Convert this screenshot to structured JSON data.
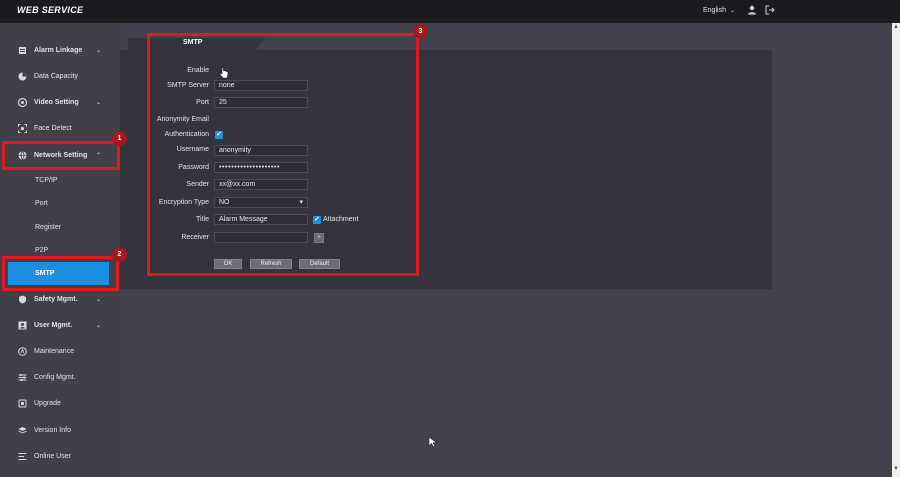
{
  "app": {
    "brand": "WEB SERVICE",
    "language": "English"
  },
  "sidebar": {
    "items": [
      {
        "label": "Alarm Linkage",
        "icon": "alarm-linkage-icon",
        "expanded": false
      },
      {
        "label": "Data Capacity",
        "icon": "pie-chart-icon"
      },
      {
        "label": "Video Setting",
        "icon": "video-icon",
        "expanded": false
      },
      {
        "label": "Face Detect",
        "icon": "face-detect-icon"
      },
      {
        "label": "Network Setting",
        "icon": "globe-icon",
        "expanded": true
      },
      {
        "label": "Safety Mgmt.",
        "icon": "shield-icon",
        "expanded": false
      },
      {
        "label": "User Mgmt.",
        "icon": "user-icon",
        "expanded": false
      },
      {
        "label": "Maintenance",
        "icon": "maintenance-icon"
      },
      {
        "label": "Config Mgmt.",
        "icon": "config-icon"
      },
      {
        "label": "Upgrade",
        "icon": "upgrade-icon"
      },
      {
        "label": "Version Info",
        "icon": "layers-icon"
      },
      {
        "label": "Online User",
        "icon": "list-icon"
      }
    ],
    "network_sub": [
      "TCP/IP",
      "Port",
      "Register",
      "P2P",
      "SMTP"
    ],
    "active_sub": "SMTP"
  },
  "annotations": [
    "1",
    "2",
    "3"
  ],
  "colors": {
    "accent": "#1e8fe0",
    "highlight": "#e0191f",
    "badge": "#a3191f"
  },
  "smtp": {
    "tab_title": "SMTP",
    "labels": {
      "enable": "Enable",
      "server": "SMTP Server",
      "port": "Port",
      "anonymity": "Anonymity Email",
      "authentication": "Authentication",
      "username": "Username",
      "password": "Password",
      "sender": "Sender",
      "encryption": "Encryption Type",
      "title": "Title",
      "receiver": "Receiver",
      "attachment": "Attachment"
    },
    "values": {
      "server": "none",
      "port": "25",
      "username": "anonymity",
      "password": "••••••••••••••••••••",
      "sender": "xx@xx.com",
      "encryption": "NO",
      "title": "Alarm Message",
      "receiver": "",
      "enable": false,
      "anonymity": false,
      "authentication": true,
      "attachment": true
    },
    "buttons": {
      "ok": "OK",
      "refresh": "Refresh",
      "default": "Default"
    },
    "add_receiver": "+"
  }
}
